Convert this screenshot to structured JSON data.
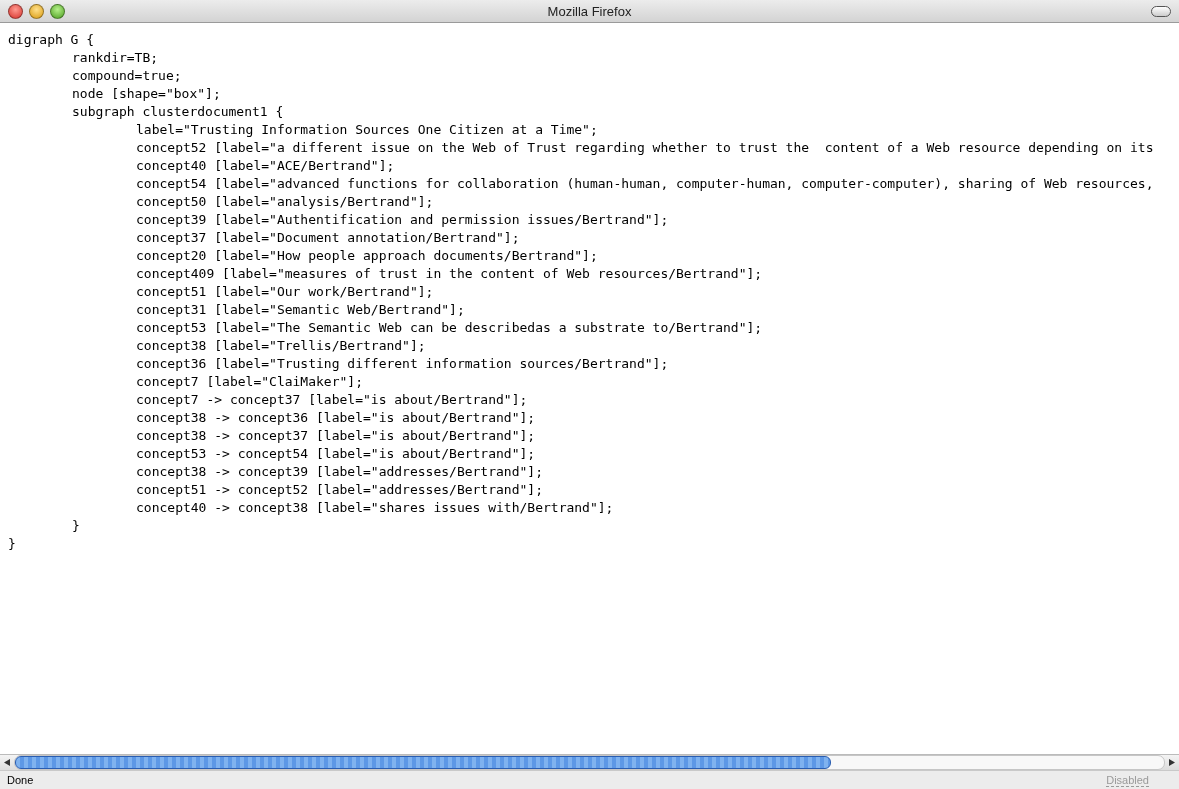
{
  "window": {
    "title": "Mozilla Firefox"
  },
  "source": {
    "lines": [
      {
        "text": "digraph G {",
        "children": [
          {
            "text": "rankdir=TB;"
          },
          {
            "text": "compound=true;"
          },
          {
            "text": "node [shape=\"box\"];"
          },
          {
            "text": "subgraph clusterdocument1 {",
            "children": [
              {
                "text": "label=\"Trusting Information Sources One Citizen at a Time\";"
              },
              {
                "text": "concept52 [label=\"a different issue on the Web of Trust regarding whether to trust the  content of a Web resource depending on its"
              },
              {
                "text": "concept40 [label=\"ACE/Bertrand\"];"
              },
              {
                "text": "concept54 [label=\"advanced functions for collaboration (human-human, computer-human, computer-computer), sharing of Web resources,"
              },
              {
                "text": "concept50 [label=\"analysis/Bertrand\"];"
              },
              {
                "text": "concept39 [label=\"Authentification and permission issues/Bertrand\"];"
              },
              {
                "text": "concept37 [label=\"Document annotation/Bertrand\"];"
              },
              {
                "text": "concept20 [label=\"How people approach documents/Bertrand\"];"
              },
              {
                "text": "concept409 [label=\"measures of trust in the content of Web resources/Bertrand\"];"
              },
              {
                "text": "concept51 [label=\"Our work/Bertrand\"];"
              },
              {
                "text": "concept31 [label=\"Semantic Web/Bertrand\"];"
              },
              {
                "text": "concept53 [label=\"The Semantic Web can be describedas a substrate to/Bertrand\"];"
              },
              {
                "text": "concept38 [label=\"Trellis/Bertrand\"];"
              },
              {
                "text": "concept36 [label=\"Trusting different information sources/Bertrand\"];"
              },
              {
                "text": "concept7 [label=\"ClaiMaker\"];"
              },
              {
                "text": "concept7 -> concept37 [label=\"is about/Bertrand\"];"
              },
              {
                "text": "concept38 -> concept36 [label=\"is about/Bertrand\"];"
              },
              {
                "text": "concept38 -> concept37 [label=\"is about/Bertrand\"];"
              },
              {
                "text": "concept53 -> concept54 [label=\"is about/Bertrand\"];"
              },
              {
                "text": "concept38 -> concept39 [label=\"addresses/Bertrand\"];"
              },
              {
                "text": "concept51 -> concept52 [label=\"addresses/Bertrand\"];"
              },
              {
                "text": "concept40 -> concept38 [label=\"shares issues with/Bertrand\"];"
              }
            ]
          },
          {
            "text": "}"
          }
        ]
      },
      {
        "text": "}"
      }
    ]
  },
  "status_bar": {
    "status": "Done",
    "popup_state": "Disabled"
  }
}
